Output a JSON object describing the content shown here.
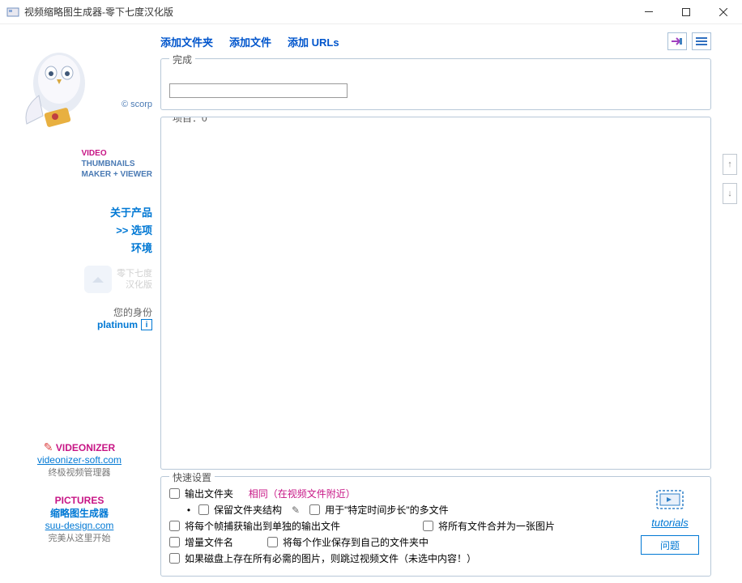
{
  "titlebar": {
    "title": "视频缩略图生成器-零下七度汉化版"
  },
  "sidebar": {
    "scorp": "© scorp",
    "logo": {
      "video": "VIDEO",
      "thumbnails": "THUMBNAILS",
      "maker": "MAKER + VIEWER"
    },
    "menu": {
      "about": "关于产品",
      "options": ">> 选项",
      "env": "环境"
    },
    "seven_below": {
      "line1": "零下七度",
      "line2": "汉化版"
    },
    "identity": {
      "label": "您的身份",
      "value": "platinum",
      "info": "i"
    },
    "videonizer": {
      "title": "VIDEONIZER",
      "link": "videonizer-soft.com",
      "desc": "终极视频管理器"
    },
    "pictures": {
      "title": "PICTURES",
      "sub": "缩略图生成器",
      "link": "suu-design.com",
      "desc": "完美从这里开始"
    }
  },
  "toolbar": {
    "add_folder": "添加文件夹",
    "add_file": "添加文件",
    "add_urls": "添加 URLs"
  },
  "groups": {
    "complete": "完成",
    "items": "项目：0"
  },
  "quick": {
    "title": "快速设置",
    "output_folder": "输出文件夹",
    "same": "相同（在视频文件附近）",
    "keep_structure": "保留文件夹结构",
    "use_time": "用于\"特定时间步长\"的多文件",
    "each_frame": "将每个帧捕获输出到单独的输出文件",
    "merge_all": "将所有文件合并为一张图片",
    "increment": "增量文件名",
    "save_own": "将每个作业保存到自己的文件夹中",
    "skip_if_exists": "如果磁盘上存在所有必需的图片，则跳过视频文件（未选中内容！）"
  },
  "right_panel": {
    "tutorials": "tutorials",
    "question": "问题"
  }
}
